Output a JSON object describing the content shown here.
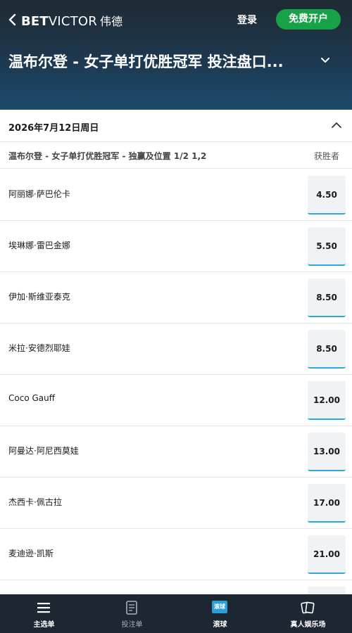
{
  "header": {
    "logo_bet": "BET",
    "logo_victor": "VICTOR",
    "logo_cn": "伟德",
    "login_label": "登录",
    "signup_label": "免费开户",
    "page_title": "温布尔登 - 女子单打优胜冠军 投注盘口..."
  },
  "event": {
    "date": "2026年7月12日周日"
  },
  "market": {
    "name": "温布尔登 - 女子单打优胜冠军 - 独赢及位置 1/2 1,2",
    "column_label": "获胜者"
  },
  "selections": [
    {
      "name": "阿丽娜·萨巴伦卡",
      "odds": "4.50"
    },
    {
      "name": "埃琳娜·雷巴金娜",
      "odds": "5.50"
    },
    {
      "name": "伊加·斯维亚泰克",
      "odds": "8.50"
    },
    {
      "name": "米拉·安德烈耶娃",
      "odds": "8.50"
    },
    {
      "name": "Coco Gauff",
      "odds": "12.00"
    },
    {
      "name": "阿曼达·阿尼西莫娃",
      "odds": "13.00"
    },
    {
      "name": "杰西卡·佩古拉",
      "odds": "17.00"
    },
    {
      "name": "麦迪逊·凯斯",
      "odds": "21.00"
    },
    {
      "name": "",
      "odds": ""
    }
  ],
  "bottom_nav": {
    "items": [
      {
        "label": "主选单",
        "icon": "menu-icon"
      },
      {
        "label": "投注单",
        "icon": "betslip-icon"
      },
      {
        "label": "滚球",
        "icon": "live-icon",
        "badge": "滚球"
      },
      {
        "label": "真人娱乐场",
        "icon": "cards-icon"
      }
    ]
  },
  "colors": {
    "header_top": "#1f2a33",
    "header_bottom": "#1b4a6a",
    "signup_green": "#17a24a",
    "odds_underline": "#2ea8d9",
    "nav_bg": "#1c2732"
  }
}
